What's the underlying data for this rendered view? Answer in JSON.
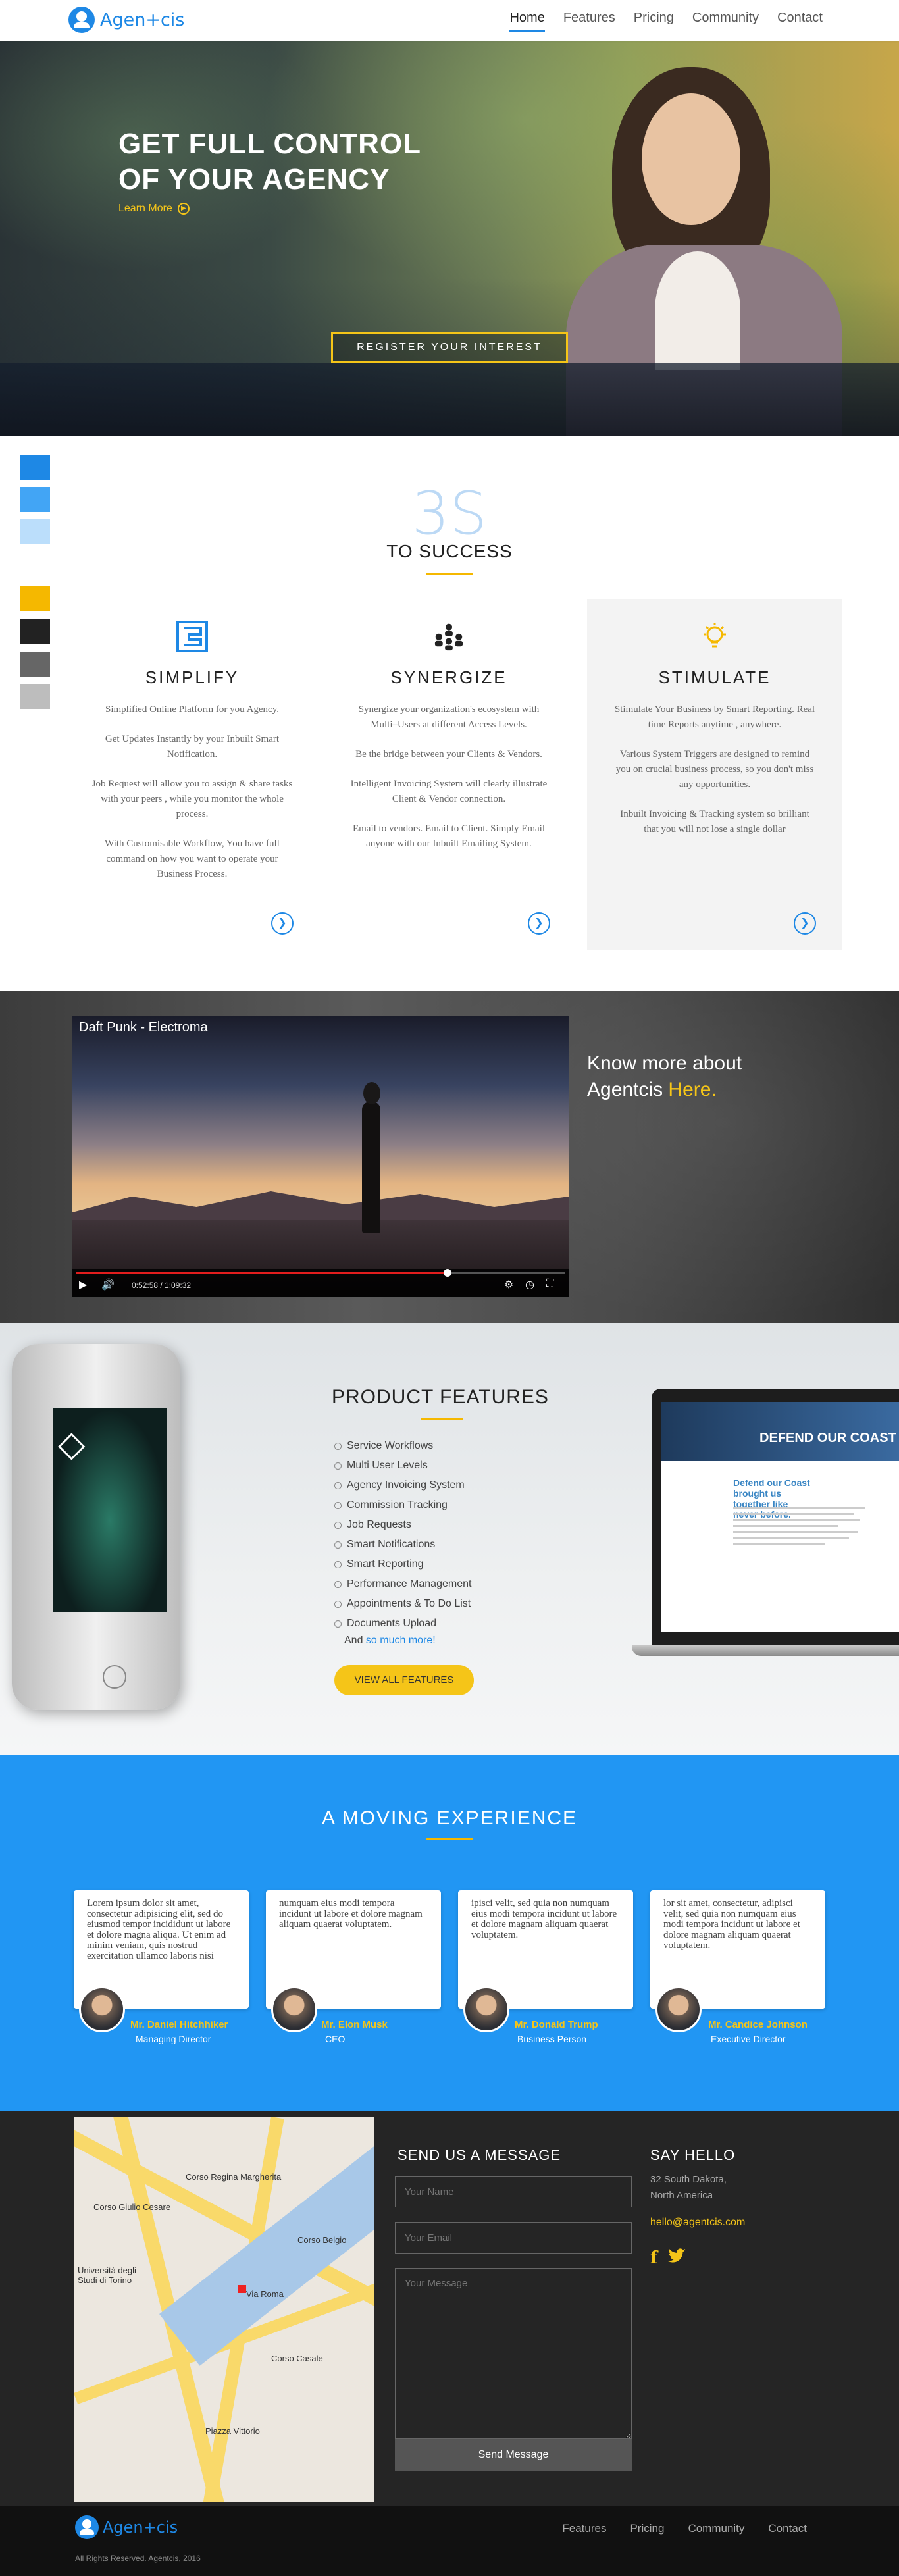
{
  "nav": {
    "logo_text": "Agen+cis",
    "links": [
      "Home",
      "Features",
      "Pricing",
      "Community",
      "Contact"
    ],
    "active": "Home"
  },
  "hero": {
    "title": "GET FULL CONTROL OF YOUR AGENCY",
    "learn_more": "Learn More",
    "cta": "REGISTER YOUR INTEREST"
  },
  "palette": [
    "#1e88e5",
    "#42a5f5",
    "#bbdefb",
    "#f5b800",
    "#222222",
    "#666666",
    "#bdbdbd"
  ],
  "success": {
    "big": "3S",
    "title": "TO SUCCESS",
    "columns": [
      {
        "icon": "maze-icon",
        "title": "SIMPLIFY",
        "paragraphs": [
          "Simplified Online Platform for you Agency.",
          "Get Updates Instantly by your Inbuilt Smart Notification.",
          "Job Request will allow you to assign & share tasks with your peers , while you monitor the whole process.",
          "With Customisable Workflow, You have full command on how you want to operate your Business Process."
        ]
      },
      {
        "icon": "people-network-icon",
        "title": "SYNERGIZE",
        "paragraphs": [
          "Synergize your organization's ecosystem with Multi–Users at different Access Levels.",
          "Be the bridge between your Clients & Vendors.",
          "Intelligent Invoicing System will clearly illustrate Client & Vendor connection.",
          "Email to vendors. Email to Client. Simply Email anyone with our Inbuilt Emailing System."
        ]
      },
      {
        "icon": "lightbulb-icon",
        "title": "STIMULATE",
        "paragraphs": [
          "Stimulate Your Business by Smart Reporting. Real time Reports anytime , anywhere.",
          "Various System Triggers are designed to remind you on crucial business process, so you don't miss any opportunities.",
          "Inbuilt Invoicing & Tracking system so brilliant that you will not lose a single dollar"
        ]
      }
    ]
  },
  "video": {
    "title": "Daft Punk - Electroma",
    "time": "0:52:58 / 1:09:32",
    "progress": 0.76,
    "know_more": "Know more about",
    "agentcis": "Agentcis",
    "here": "Here."
  },
  "features": {
    "title": "PRODUCT FEATURES",
    "items": [
      "Service Workflows",
      "Multi User Levels",
      "Agency Invoicing System",
      "Commission Tracking",
      "Job Requests",
      "Smart Notifications",
      "Smart Reporting",
      "Performance Management",
      "Appointments & To Do List",
      "Documents Upload"
    ],
    "and": "And",
    "more": "so much more!",
    "button": "VIEW ALL FEATURES",
    "laptop_headline": "DEFEND OUR COAST",
    "laptop_sub": "Defend our Coast brought us together like never before."
  },
  "moving": {
    "title": "A MOVING EXPERIENCE",
    "testimonials": [
      {
        "text": "Lorem ipsum dolor sit amet, consectetur adipisicing elit, sed do eiusmod tempor incididunt ut labore et dolore magna aliqua. Ut enim ad minim veniam, quis nostrud exercitation ullamco laboris nisi",
        "name": "Mr. Daniel Hitchhiker",
        "role": "Managing Director"
      },
      {
        "text": "numquam eius modi tempora incidunt ut labore et dolore magnam aliquam quaerat voluptatem.",
        "name": "Mr. Elon Musk",
        "role": "CEO"
      },
      {
        "text": "ipisci velit, sed quia non numquam eius modi tempora incidunt ut labore et dolore magnam aliquam quaerat voluptatem.",
        "name": "Mr. Donald Trump",
        "role": "Business Person"
      },
      {
        "text": "lor sit amet, consectetur, adipisci velit, sed quia non numquam eius modi tempora incidunt ut labore et dolore magnam aliquam quaerat voluptatem.",
        "name": "Mr. Candice Johnson",
        "role": "Executive Director"
      }
    ]
  },
  "contact": {
    "title": "SEND US A MESSAGE",
    "name_ph": "Your Name",
    "email_ph": "Your Email",
    "message_ph": "Your Message",
    "send": "Send Message",
    "hello_title": "SAY HELLO",
    "address1": "32 South Dakota,",
    "address2": "North America",
    "email": "hello@agentcis.com",
    "map_labels": [
      "Università degli Studi di Torino",
      "Corso Regina Margherita",
      "Corso Casale",
      "Corso Giulio Cesare",
      "Piazza Vittorio",
      "Via Roma",
      "Corso Belgio"
    ]
  },
  "footer": {
    "logo_text": "Agen+cis",
    "links": [
      "Features",
      "Pricing",
      "Community",
      "Contact"
    ],
    "copyright": "All Rights Reserved. Agentcis, 2016"
  }
}
